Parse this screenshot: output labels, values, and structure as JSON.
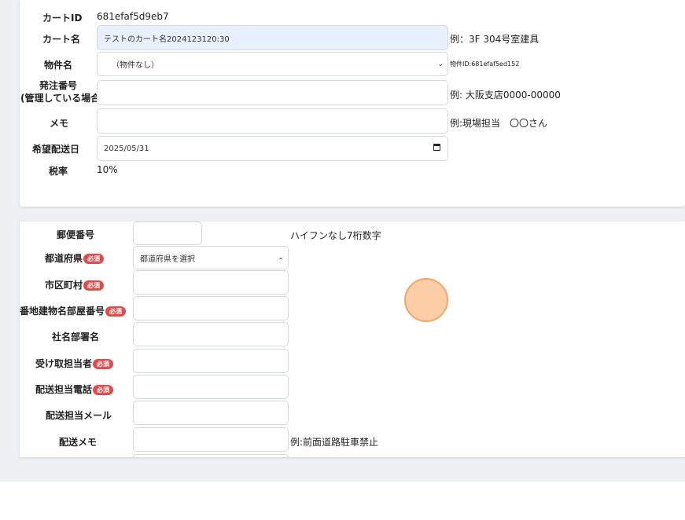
{
  "cart": {
    "cart_id_label": "カートID",
    "cart_id_value": "681efaf5d9eb7",
    "cart_name_label": "カート名",
    "cart_name_value": "テストのカート名2024123120:30",
    "cart_name_hint": "例：3F 304号室建具",
    "property_label": "物件名",
    "property_value": "（物件なし）",
    "property_hint": "物件ID:681efaf5ed152",
    "order_no_label_line1": "発注番号",
    "order_no_label_line2": "(管理している場合)",
    "order_no_value": "",
    "order_no_hint": "例: 大阪支店0000-00000",
    "memo_label": "メモ",
    "memo_value": "",
    "memo_hint": "例:現場担当　〇〇さん",
    "delivery_date_label": "希望配送日",
    "delivery_date_value": "2025/05/31",
    "tax_label": "税率",
    "tax_value": "10%"
  },
  "delivery": {
    "required_badge": "必須",
    "postal_label": "郵便番号",
    "postal_value": "",
    "postal_hint": "ハイフンなし7桁数字",
    "prefecture_label": "都道府県",
    "prefecture_value": "都道府県を選択",
    "city_label": "市区町村",
    "city_value": "",
    "address_label": "番地建物名部屋番号",
    "address_value": "",
    "company_label": "社名部署名",
    "company_value": "",
    "recipient_label": "受け取担当者",
    "recipient_value": "",
    "phone_label": "配送担当電話",
    "phone_value": "",
    "email_label": "配送担当メール",
    "email_value": "",
    "memo_label": "配送メモ",
    "memo_value": "",
    "memo_hint": "例:前面道路駐車禁止"
  }
}
